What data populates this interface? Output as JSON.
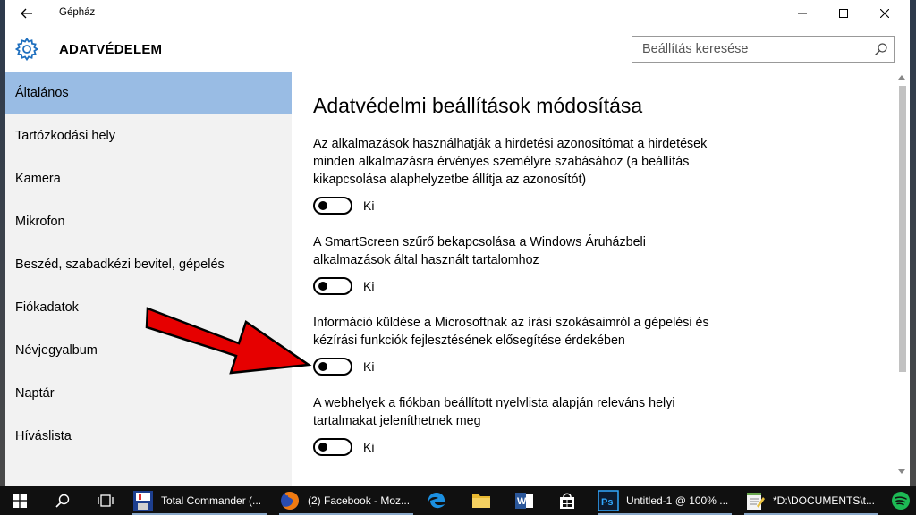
{
  "window": {
    "app_title": "Gépház",
    "section_title": "ADATVÉDELEM",
    "search_placeholder": "Beállítás keresése"
  },
  "sidebar": {
    "items": [
      {
        "label": "Általános",
        "active": true
      },
      {
        "label": "Tartózkodási hely"
      },
      {
        "label": "Kamera"
      },
      {
        "label": "Mikrofon"
      },
      {
        "label": "Beszéd, szabadkézi bevitel, gépelés"
      },
      {
        "label": "Fiókadatok"
      },
      {
        "label": "Névjegyalbum"
      },
      {
        "label": "Naptár"
      },
      {
        "label": "Híváslista"
      }
    ]
  },
  "content": {
    "heading": "Adatvédelmi beállítások módosítása",
    "settings": [
      {
        "description": "Az alkalmazások használhatják a hirdetési azonosítómat a hirdetések minden alkalmazásra érvényes személyre szabásához (a beállítás kikapcsolása alaphelyzetbe állítja az azonosítót)",
        "toggle_label": "Ki",
        "on": false
      },
      {
        "description": "A SmartScreen szűrő bekapcsolása a Windows Áruházbeli alkalmazások által használt tartalomhoz",
        "toggle_label": "Ki",
        "on": false
      },
      {
        "description": "Információ küldése a Microsoftnak az írási szokásaimról a gépelési és kézírási funkciók fejlesztésének elősegítése érdekében",
        "toggle_label": "Ki",
        "on": false
      },
      {
        "description": "A webhelyek a fiókban beállított nyelvlista alapján releváns helyi tartalmakat jeleníthetnek meg",
        "toggle_label": "Ki",
        "on": false
      }
    ]
  },
  "taskbar": {
    "apps": [
      {
        "label": "Total Commander (...",
        "icon": "total-commander-icon"
      },
      {
        "label": "(2) Facebook - Moz...",
        "icon": "firefox-icon"
      },
      {
        "label": "Untitled-1 @ 100% ...",
        "icon": "photoshop-icon"
      },
      {
        "label": "*D:\\DOCUMENTS\\t...",
        "icon": "notepad-icon"
      }
    ]
  },
  "colors": {
    "sidebar_bg": "#f2f2f2",
    "active_item": "#99bce4",
    "arrow": "#e60000",
    "taskbar": "#101010"
  }
}
